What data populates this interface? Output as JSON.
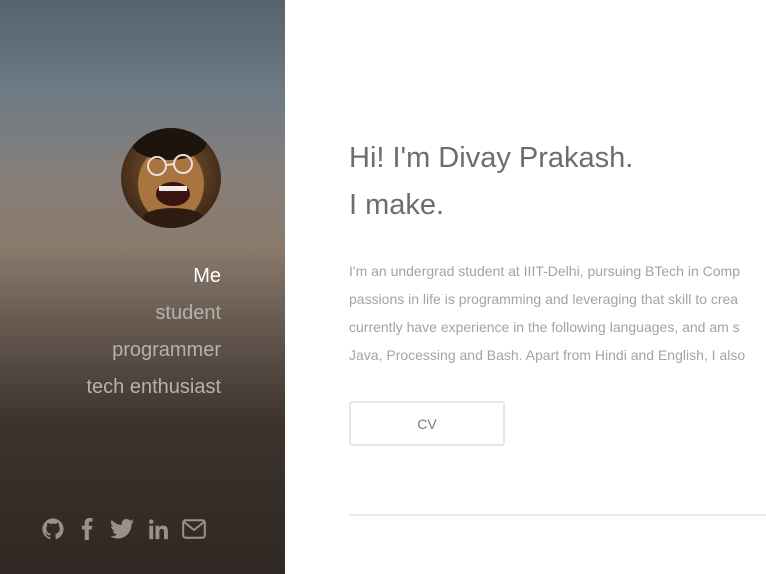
{
  "profile": {
    "avatar_alt": "Divay Prakash"
  },
  "nav": {
    "items": [
      {
        "label": "Me",
        "active": true
      },
      {
        "label": "student",
        "active": false
      },
      {
        "label": "programmer",
        "active": false
      },
      {
        "label": "tech enthusiast",
        "active": false
      }
    ]
  },
  "social": {
    "icons": [
      "github-icon",
      "facebook-icon",
      "twitter-icon",
      "linkedin-icon",
      "mail-icon"
    ]
  },
  "main": {
    "headline_line1": "Hi! I'm Divay Prakash.",
    "headline_line2": "I make.",
    "intro_lines": [
      "I'm an undergrad student at IIIT-Delhi, pursuing BTech in Comp",
      "passions in life is programming and leveraging that skill to crea",
      "currently have experience in the following languages, and am s",
      "Java, Processing and Bash. Apart from Hindi and English, I also"
    ],
    "cv_label": "CV"
  },
  "colors": {
    "sidebar_top": "#56636f",
    "sidebar_bottom": "#2f2823",
    "nav_active": "#ffffff",
    "nav_inactive": "#b8b1ab",
    "headline": "#6d6d6d",
    "body_text": "#a3a3a3"
  }
}
